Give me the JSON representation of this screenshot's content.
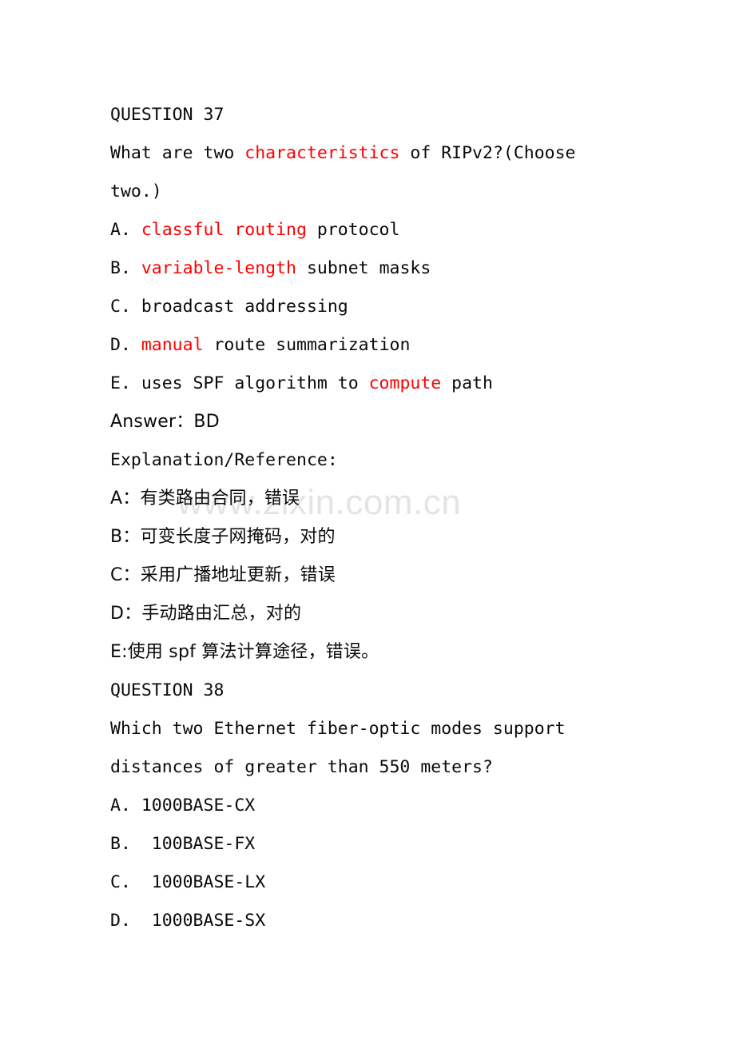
{
  "document": {
    "page_background": "#ffffff",
    "text_color": "#0a0a0a",
    "highlight_color": "#ff0000"
  },
  "watermark": {
    "text": "www.zixin.com.cn",
    "color": "#e4e4e4"
  },
  "questions": [
    {
      "heading": "QUESTION 37",
      "stem_lines": [
        [
          {
            "t": "What are two ",
            "c": "black"
          },
          {
            "t": "characteristics",
            "c": "red"
          },
          {
            "t": " of RIPv2?(Choose",
            "c": "black"
          }
        ],
        [
          {
            "t": "two.)",
            "c": "black"
          }
        ]
      ],
      "options": [
        [
          {
            "t": "A. ",
            "c": "black"
          },
          {
            "t": "classful routing",
            "c": "red"
          },
          {
            "t": " protocol",
            "c": "black"
          }
        ],
        [
          {
            "t": "B. ",
            "c": "black"
          },
          {
            "t": "variable-length",
            "c": "red"
          },
          {
            "t": " subnet masks",
            "c": "black"
          }
        ],
        [
          {
            "t": "C. broadcast addressing",
            "c": "black"
          }
        ],
        [
          {
            "t": "D. ",
            "c": "black"
          },
          {
            "t": "manual",
            "c": "red"
          },
          {
            "t": " route summarization",
            "c": "black"
          }
        ],
        [
          {
            "t": "E. uses SPF algorithm to ",
            "c": "black"
          },
          {
            "t": "compute",
            "c": "red"
          },
          {
            "t": " path",
            "c": "black"
          }
        ]
      ],
      "answer_line": "Answer：BD",
      "explanation_label": "Explanation/Reference:",
      "explanation_lines": [
        "A：有类路由合同，错误",
        "B：可变长度子网掩码，对的",
        "C：采用广播地址更新，错误",
        "D：手动路由汇总，对的",
        "E:使用 spf 算法计算途径，错误。"
      ]
    },
    {
      "heading": "QUESTION 38",
      "stem_lines": [
        [
          {
            "t": "Which two Ethernet fiber-optic modes support",
            "c": "black"
          }
        ],
        [
          {
            "t": "distances of greater than 550 meters?",
            "c": "black"
          }
        ]
      ],
      "options": [
        [
          {
            "t": "A. 1000BASE-CX",
            "c": "black"
          }
        ],
        [
          {
            "t": "B.  100BASE-FX",
            "c": "black"
          }
        ],
        [
          {
            "t": "C.  1000BASE-LX",
            "c": "black"
          }
        ],
        [
          {
            "t": "D.  1000BASE-SX",
            "c": "black"
          }
        ]
      ],
      "answer_line": "",
      "explanation_label": "",
      "explanation_lines": []
    }
  ]
}
